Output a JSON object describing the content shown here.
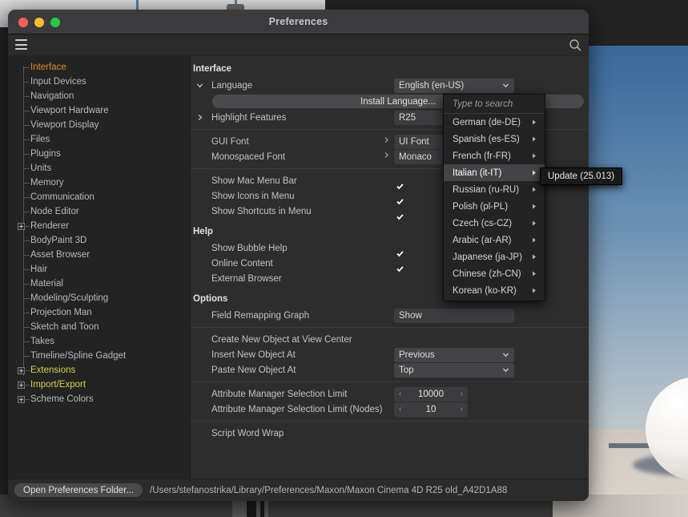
{
  "window": {
    "title": "Preferences",
    "traffic_lights": [
      "close-red",
      "minimize-yellow",
      "maximize-green"
    ],
    "toolbar": {
      "menu_icon": "hamburger-icon",
      "search_icon": "search-icon"
    }
  },
  "sidebar": {
    "items": [
      {
        "label": "Interface",
        "expandable": false,
        "state": "selected"
      },
      {
        "label": "Input Devices",
        "expandable": false,
        "state": "normal"
      },
      {
        "label": "Navigation",
        "expandable": false,
        "state": "normal"
      },
      {
        "label": "Viewport Hardware",
        "expandable": false,
        "state": "normal"
      },
      {
        "label": "Viewport Display",
        "expandable": false,
        "state": "normal"
      },
      {
        "label": "Files",
        "expandable": false,
        "state": "normal"
      },
      {
        "label": "Plugins",
        "expandable": false,
        "state": "normal"
      },
      {
        "label": "Units",
        "expandable": false,
        "state": "normal"
      },
      {
        "label": "Memory",
        "expandable": false,
        "state": "normal"
      },
      {
        "label": "Communication",
        "expandable": false,
        "state": "normal"
      },
      {
        "label": "Node Editor",
        "expandable": false,
        "state": "normal"
      },
      {
        "label": "Renderer",
        "expandable": true,
        "state": "normal"
      },
      {
        "label": "BodyPaint 3D",
        "expandable": false,
        "state": "normal"
      },
      {
        "label": "Asset Browser",
        "expandable": false,
        "state": "normal"
      },
      {
        "label": "Hair",
        "expandable": false,
        "state": "normal"
      },
      {
        "label": "Material",
        "expandable": false,
        "state": "normal"
      },
      {
        "label": "Modeling/Sculpting",
        "expandable": false,
        "state": "normal"
      },
      {
        "label": "Projection Man",
        "expandable": false,
        "state": "normal"
      },
      {
        "label": "Sketch and Toon",
        "expandable": false,
        "state": "normal"
      },
      {
        "label": "Takes",
        "expandable": false,
        "state": "normal"
      },
      {
        "label": "Timeline/Spline Gadget",
        "expandable": false,
        "state": "normal"
      },
      {
        "label": "Extensions",
        "expandable": true,
        "state": "highlight"
      },
      {
        "label": "Import/Export",
        "expandable": true,
        "state": "highlight"
      },
      {
        "label": "Scheme Colors",
        "expandable": true,
        "state": "normal"
      }
    ]
  },
  "main": {
    "interface": {
      "heading": "Interface",
      "language_label": "Language",
      "language_value": "English (en-US)",
      "install_language_button": "Install Language...",
      "highlight_features_label": "Highlight Features",
      "highlight_features_value": "R25",
      "gui_font_label": "GUI Font",
      "gui_font_value": "UI Font",
      "monospaced_font_label": "Monospaced Font",
      "monospaced_font_value": "Monaco",
      "show_mac_menu_bar_label": "Show Mac Menu Bar",
      "show_mac_menu_bar_checked": true,
      "show_icons_in_menu_label": "Show Icons in Menu",
      "show_icons_in_menu_checked": true,
      "show_shortcuts_in_menu_label": "Show Shortcuts in Menu",
      "show_shortcuts_in_menu_checked": true
    },
    "help": {
      "heading": "Help",
      "show_bubble_help_label": "Show Bubble Help",
      "show_bubble_help_checked": true,
      "online_content_label": "Online Content",
      "online_content_checked": true,
      "external_browser_label": "External Browser",
      "external_browser_checked": false
    },
    "options": {
      "heading": "Options",
      "field_remapping_graph_label": "Field Remapping Graph",
      "field_remapping_graph_value": "Show",
      "create_new_object_label": "Create New Object at View Center",
      "create_new_object_checked": false,
      "insert_new_object_label": "Insert New Object At",
      "insert_new_object_value": "Previous",
      "paste_new_object_label": "Paste New Object At",
      "paste_new_object_value": "Top",
      "attr_limit_label": "Attribute Manager Selection Limit",
      "attr_limit_value": "10000",
      "attr_limit_nodes_label": "Attribute Manager Selection Limit (Nodes)",
      "attr_limit_nodes_value": "10",
      "script_word_wrap_label": "Script Word Wrap",
      "script_word_wrap_checked": false
    }
  },
  "language_menu": {
    "search_placeholder": "Type to search",
    "items": [
      {
        "label": "German (de-DE)",
        "active": false
      },
      {
        "label": "Spanish (es-ES)",
        "active": false
      },
      {
        "label": "French (fr-FR)",
        "active": false
      },
      {
        "label": "Italian (it-IT)",
        "active": true
      },
      {
        "label": "Russian (ru-RU)",
        "active": false
      },
      {
        "label": "Polish (pl-PL)",
        "active": false
      },
      {
        "label": "Czech (cs-CZ)",
        "active": false
      },
      {
        "label": "Arabic (ar-AR)",
        "active": false
      },
      {
        "label": "Japanese (ja-JP)",
        "active": false
      },
      {
        "label": "Chinese (zh-CN)",
        "active": false
      },
      {
        "label": "Korean (ko-KR)",
        "active": false
      }
    ],
    "submenu_item": "Update (25.013)"
  },
  "footer": {
    "button_label": "Open Preferences Folder...",
    "path": "/Users/stefanostrika/Library/Preferences/Maxon/Maxon Cinema 4D R25 old_A42D1A88"
  },
  "colors": {
    "accent_selected": "#e38a23",
    "accent_highlight": "#d4d24a",
    "checkbox_on": "#5f62c4",
    "window_bg": "#2d2d2d",
    "sidebar_bg": "#232323"
  }
}
